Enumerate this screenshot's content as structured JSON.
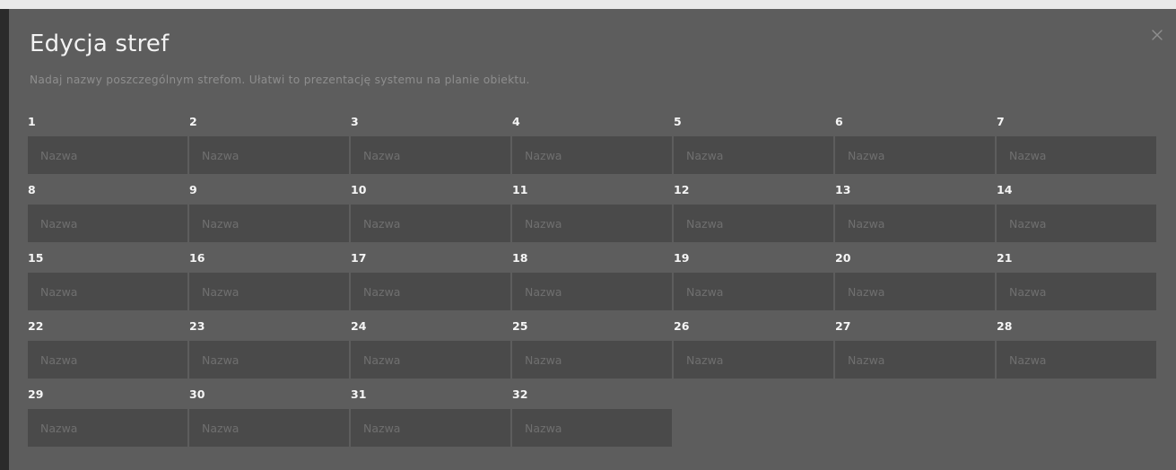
{
  "dialog": {
    "title": "Edycja stref",
    "subtitle": "Nadaj nazwy poszczególnym strefom. Ułatwi to prezentację systemu na planie obiektu.",
    "close_icon": "close-icon"
  },
  "zones": [
    {
      "label": "1",
      "value": "",
      "placeholder": "Nazwa"
    },
    {
      "label": "2",
      "value": "",
      "placeholder": "Nazwa"
    },
    {
      "label": "3",
      "value": "",
      "placeholder": "Nazwa"
    },
    {
      "label": "4",
      "value": "",
      "placeholder": "Nazwa"
    },
    {
      "label": "5",
      "value": "",
      "placeholder": "Nazwa"
    },
    {
      "label": "6",
      "value": "",
      "placeholder": "Nazwa"
    },
    {
      "label": "7",
      "value": "",
      "placeholder": "Nazwa"
    },
    {
      "label": "8",
      "value": "",
      "placeholder": "Nazwa"
    },
    {
      "label": "9",
      "value": "",
      "placeholder": "Nazwa"
    },
    {
      "label": "10",
      "value": "",
      "placeholder": "Nazwa"
    },
    {
      "label": "11",
      "value": "",
      "placeholder": "Nazwa"
    },
    {
      "label": "12",
      "value": "",
      "placeholder": "Nazwa"
    },
    {
      "label": "13",
      "value": "",
      "placeholder": "Nazwa"
    },
    {
      "label": "14",
      "value": "",
      "placeholder": "Nazwa"
    },
    {
      "label": "15",
      "value": "",
      "placeholder": "Nazwa"
    },
    {
      "label": "16",
      "value": "",
      "placeholder": "Nazwa"
    },
    {
      "label": "17",
      "value": "",
      "placeholder": "Nazwa"
    },
    {
      "label": "18",
      "value": "",
      "placeholder": "Nazwa"
    },
    {
      "label": "19",
      "value": "",
      "placeholder": "Nazwa"
    },
    {
      "label": "20",
      "value": "",
      "placeholder": "Nazwa"
    },
    {
      "label": "21",
      "value": "",
      "placeholder": "Nazwa"
    },
    {
      "label": "22",
      "value": "",
      "placeholder": "Nazwa"
    },
    {
      "label": "23",
      "value": "",
      "placeholder": "Nazwa"
    },
    {
      "label": "24",
      "value": "",
      "placeholder": "Nazwa"
    },
    {
      "label": "25",
      "value": "",
      "placeholder": "Nazwa"
    },
    {
      "label": "26",
      "value": "",
      "placeholder": "Nazwa"
    },
    {
      "label": "27",
      "value": "",
      "placeholder": "Nazwa"
    },
    {
      "label": "28",
      "value": "",
      "placeholder": "Nazwa"
    },
    {
      "label": "29",
      "value": "",
      "placeholder": "Nazwa"
    },
    {
      "label": "30",
      "value": "",
      "placeholder": "Nazwa"
    },
    {
      "label": "31",
      "value": "",
      "placeholder": "Nazwa"
    },
    {
      "label": "32",
      "value": "",
      "placeholder": "Nazwa"
    }
  ],
  "colors": {
    "page_strip": "#e9e9e9",
    "modal_background": "#5d5d5d",
    "input_background": "#4a4a4a",
    "label_text": "#f5f5f5",
    "subtitle_text": "#8e8e8e",
    "placeholder_text": "#6f6f6f"
  }
}
